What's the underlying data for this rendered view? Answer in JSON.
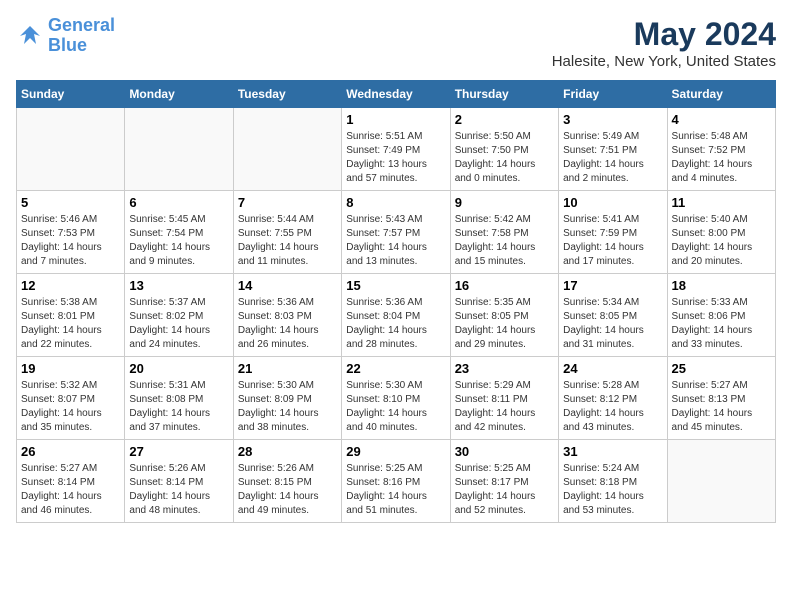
{
  "header": {
    "logo_line1": "General",
    "logo_line2": "Blue",
    "month_year": "May 2024",
    "location": "Halesite, New York, United States"
  },
  "days_of_week": [
    "Sunday",
    "Monday",
    "Tuesday",
    "Wednesday",
    "Thursday",
    "Friday",
    "Saturday"
  ],
  "weeks": [
    [
      {
        "day": "",
        "info": ""
      },
      {
        "day": "",
        "info": ""
      },
      {
        "day": "",
        "info": ""
      },
      {
        "day": "1",
        "info": "Sunrise: 5:51 AM\nSunset: 7:49 PM\nDaylight: 13 hours and 57 minutes."
      },
      {
        "day": "2",
        "info": "Sunrise: 5:50 AM\nSunset: 7:50 PM\nDaylight: 14 hours and 0 minutes."
      },
      {
        "day": "3",
        "info": "Sunrise: 5:49 AM\nSunset: 7:51 PM\nDaylight: 14 hours and 2 minutes."
      },
      {
        "day": "4",
        "info": "Sunrise: 5:48 AM\nSunset: 7:52 PM\nDaylight: 14 hours and 4 minutes."
      }
    ],
    [
      {
        "day": "5",
        "info": "Sunrise: 5:46 AM\nSunset: 7:53 PM\nDaylight: 14 hours and 7 minutes."
      },
      {
        "day": "6",
        "info": "Sunrise: 5:45 AM\nSunset: 7:54 PM\nDaylight: 14 hours and 9 minutes."
      },
      {
        "day": "7",
        "info": "Sunrise: 5:44 AM\nSunset: 7:55 PM\nDaylight: 14 hours and 11 minutes."
      },
      {
        "day": "8",
        "info": "Sunrise: 5:43 AM\nSunset: 7:57 PM\nDaylight: 14 hours and 13 minutes."
      },
      {
        "day": "9",
        "info": "Sunrise: 5:42 AM\nSunset: 7:58 PM\nDaylight: 14 hours and 15 minutes."
      },
      {
        "day": "10",
        "info": "Sunrise: 5:41 AM\nSunset: 7:59 PM\nDaylight: 14 hours and 17 minutes."
      },
      {
        "day": "11",
        "info": "Sunrise: 5:40 AM\nSunset: 8:00 PM\nDaylight: 14 hours and 20 minutes."
      }
    ],
    [
      {
        "day": "12",
        "info": "Sunrise: 5:38 AM\nSunset: 8:01 PM\nDaylight: 14 hours and 22 minutes."
      },
      {
        "day": "13",
        "info": "Sunrise: 5:37 AM\nSunset: 8:02 PM\nDaylight: 14 hours and 24 minutes."
      },
      {
        "day": "14",
        "info": "Sunrise: 5:36 AM\nSunset: 8:03 PM\nDaylight: 14 hours and 26 minutes."
      },
      {
        "day": "15",
        "info": "Sunrise: 5:36 AM\nSunset: 8:04 PM\nDaylight: 14 hours and 28 minutes."
      },
      {
        "day": "16",
        "info": "Sunrise: 5:35 AM\nSunset: 8:05 PM\nDaylight: 14 hours and 29 minutes."
      },
      {
        "day": "17",
        "info": "Sunrise: 5:34 AM\nSunset: 8:05 PM\nDaylight: 14 hours and 31 minutes."
      },
      {
        "day": "18",
        "info": "Sunrise: 5:33 AM\nSunset: 8:06 PM\nDaylight: 14 hours and 33 minutes."
      }
    ],
    [
      {
        "day": "19",
        "info": "Sunrise: 5:32 AM\nSunset: 8:07 PM\nDaylight: 14 hours and 35 minutes."
      },
      {
        "day": "20",
        "info": "Sunrise: 5:31 AM\nSunset: 8:08 PM\nDaylight: 14 hours and 37 minutes."
      },
      {
        "day": "21",
        "info": "Sunrise: 5:30 AM\nSunset: 8:09 PM\nDaylight: 14 hours and 38 minutes."
      },
      {
        "day": "22",
        "info": "Sunrise: 5:30 AM\nSunset: 8:10 PM\nDaylight: 14 hours and 40 minutes."
      },
      {
        "day": "23",
        "info": "Sunrise: 5:29 AM\nSunset: 8:11 PM\nDaylight: 14 hours and 42 minutes."
      },
      {
        "day": "24",
        "info": "Sunrise: 5:28 AM\nSunset: 8:12 PM\nDaylight: 14 hours and 43 minutes."
      },
      {
        "day": "25",
        "info": "Sunrise: 5:27 AM\nSunset: 8:13 PM\nDaylight: 14 hours and 45 minutes."
      }
    ],
    [
      {
        "day": "26",
        "info": "Sunrise: 5:27 AM\nSunset: 8:14 PM\nDaylight: 14 hours and 46 minutes."
      },
      {
        "day": "27",
        "info": "Sunrise: 5:26 AM\nSunset: 8:14 PM\nDaylight: 14 hours and 48 minutes."
      },
      {
        "day": "28",
        "info": "Sunrise: 5:26 AM\nSunset: 8:15 PM\nDaylight: 14 hours and 49 minutes."
      },
      {
        "day": "29",
        "info": "Sunrise: 5:25 AM\nSunset: 8:16 PM\nDaylight: 14 hours and 51 minutes."
      },
      {
        "day": "30",
        "info": "Sunrise: 5:25 AM\nSunset: 8:17 PM\nDaylight: 14 hours and 52 minutes."
      },
      {
        "day": "31",
        "info": "Sunrise: 5:24 AM\nSunset: 8:18 PM\nDaylight: 14 hours and 53 minutes."
      },
      {
        "day": "",
        "info": ""
      }
    ]
  ]
}
